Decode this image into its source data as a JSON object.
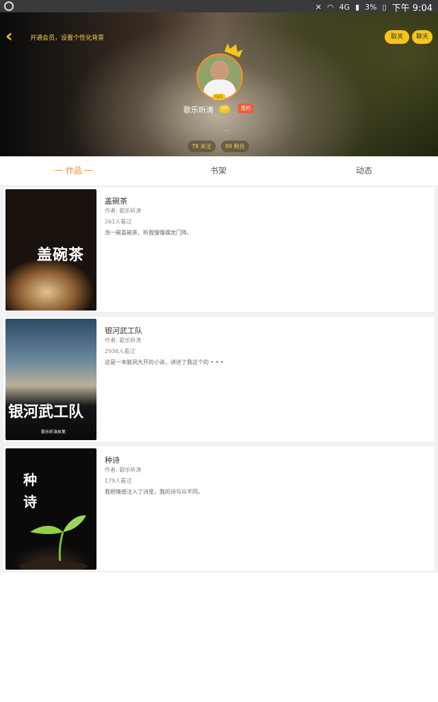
{
  "statusbar": {
    "icons": [
      "mute-icon",
      "wifi-icon",
      "signal-icon",
      "battery-icon"
    ],
    "network": "4G",
    "battery": "3%",
    "time": "下午 9:04"
  },
  "header": {
    "promo": "开通会员，设置个性化背景",
    "cancel_follow": "取关",
    "chat": "聊天",
    "level": "LV1",
    "nickname": "歌乐听涛",
    "vip_label": "VIP",
    "sign_label": "签约",
    "dots": "…",
    "following": "78 关注",
    "fans": "88 粉丝"
  },
  "tabs": [
    {
      "label": "一 作品 一",
      "active": true
    },
    {
      "label": "书架",
      "active": false
    },
    {
      "label": "动态",
      "active": false
    }
  ],
  "books": [
    {
      "title": "盖碗茶",
      "author": "作者: 歌乐听涛",
      "reads": "261人看过",
      "desc": "泡一碗盖碗茶，听我慢慢摆龙门阵。",
      "cover_text": "盖碗茶"
    },
    {
      "title": "银河武工队",
      "author": "作者: 歌乐听涛",
      "reads": "2936人看过",
      "desc": "这是一本脑洞大开的小说，讲述了我这个的 • • •",
      "cover_text": "银河武工队",
      "cover_sub": "歌乐听涛执笔"
    },
    {
      "title": "种诗",
      "author": "作者: 歌乐听涛",
      "reads": "179人看过",
      "desc": "我把情感注入了诗里，我的诗与众不同。",
      "cover_text": "种诗"
    }
  ],
  "colors": {
    "accent": "#f5c518",
    "tab_active": "#f08c2e",
    "sign": "#e8603c"
  }
}
